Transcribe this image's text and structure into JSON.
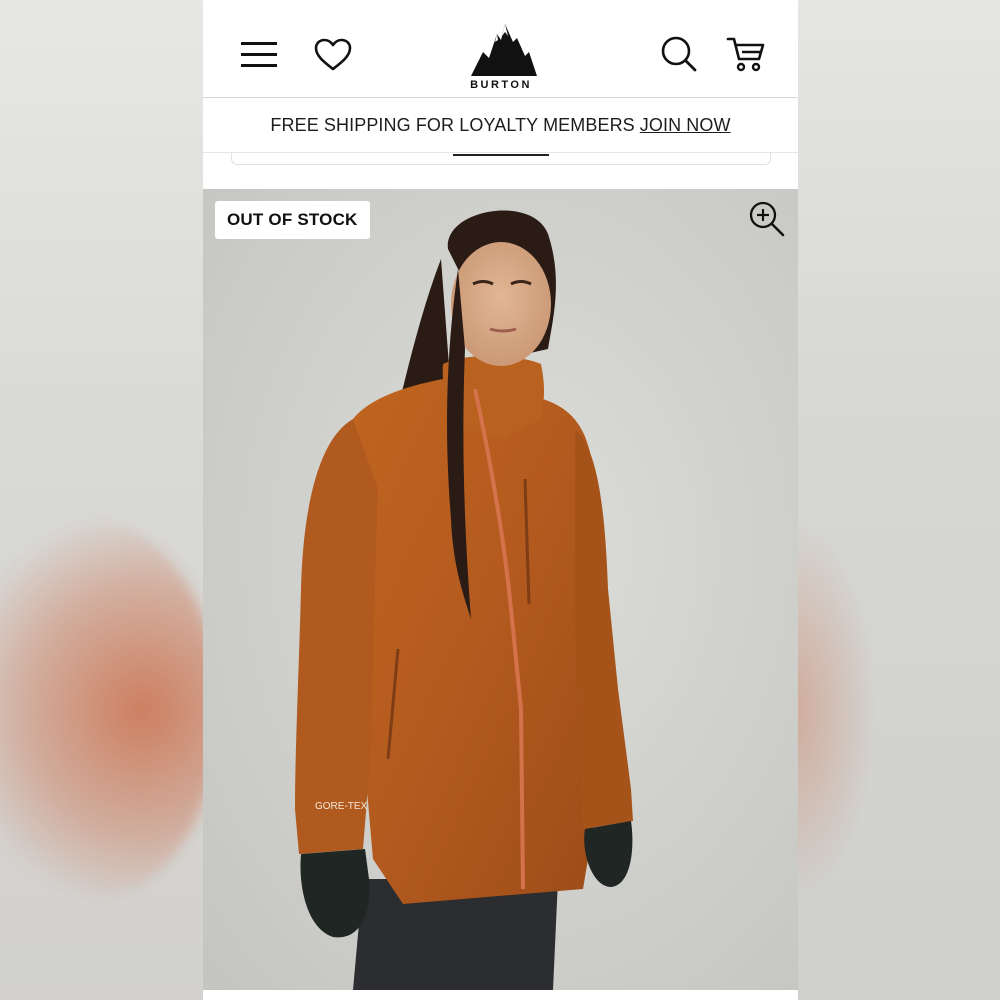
{
  "header": {
    "menu_icon": "hamburger-menu-icon",
    "wishlist_icon": "heart-icon",
    "brand": "BURTON",
    "search_icon": "search-icon",
    "cart_icon": "shopping-cart-icon"
  },
  "promo": {
    "text": "FREE SHIPPING FOR LOYALTY MEMBERS",
    "link": "JOIN NOW"
  },
  "product": {
    "badge": "OUT OF STOCK",
    "zoom_icon": "zoom-in-icon",
    "jacket_label": "GORE-TEX",
    "jacket_color": "#b35a1f"
  }
}
